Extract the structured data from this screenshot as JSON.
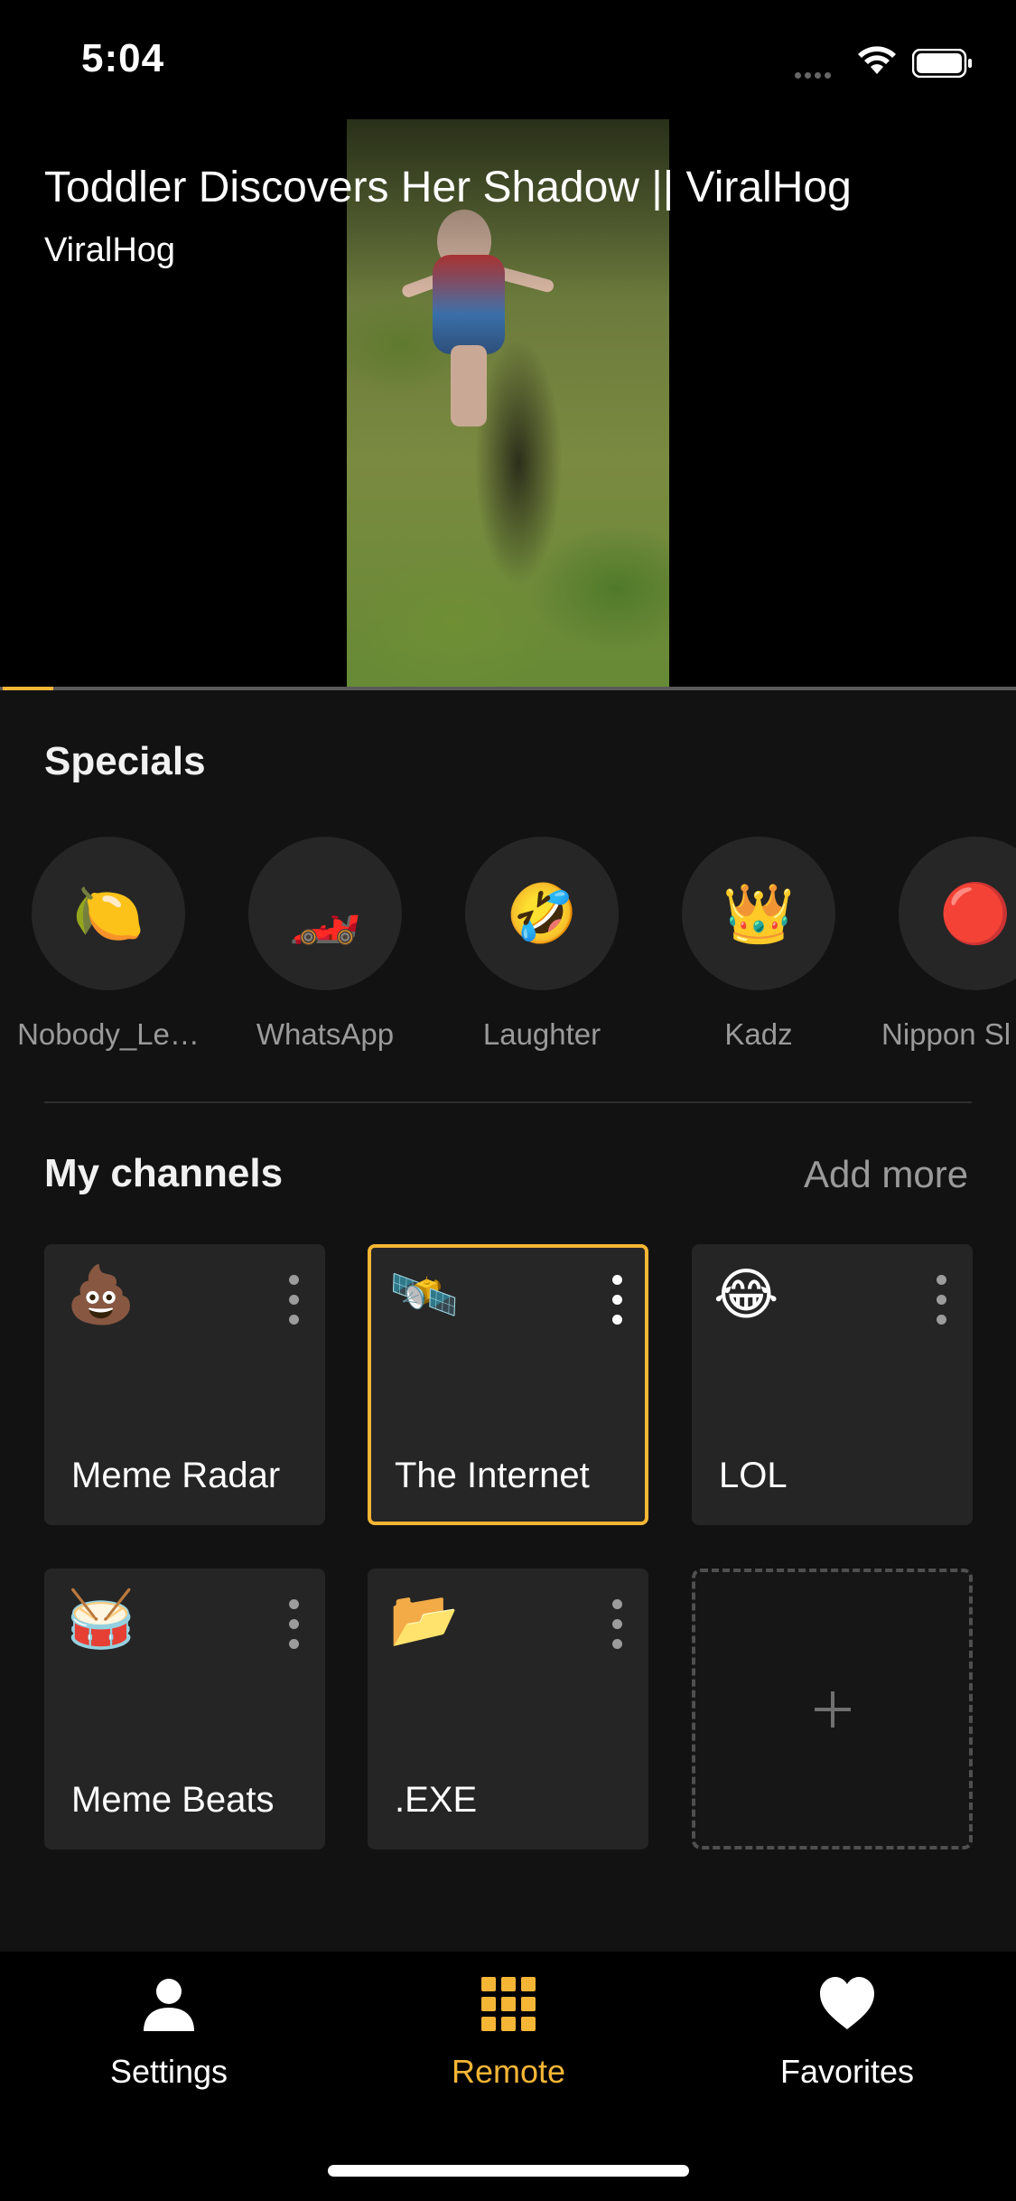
{
  "status_bar": {
    "time": "5:04"
  },
  "video": {
    "title": "Toddler Discovers Her Shadow || ViralHog",
    "channel": "ViralHog",
    "progress": 0.05
  },
  "specials": {
    "title": "Specials",
    "items": [
      {
        "label": "Nobody_Le…",
        "icon": "🍋"
      },
      {
        "label": "WhatsApp",
        "icon": "🏎️"
      },
      {
        "label": "Laughter",
        "icon": "🤣"
      },
      {
        "label": "Kadz",
        "icon": "👑"
      },
      {
        "label": "Nippon Sl",
        "icon": "🔴"
      }
    ]
  },
  "channels": {
    "title": "My channels",
    "add_more": "Add more",
    "items": [
      {
        "label": "Meme Radar",
        "icon": "💩"
      },
      {
        "label": "The Internet",
        "icon": "🛰️",
        "selected": true
      },
      {
        "label": "LOL",
        "icon": "😂"
      },
      {
        "label": "Meme Beats",
        "icon": "🥁"
      },
      {
        "label": ".EXE",
        "icon": "📂"
      }
    ],
    "add_tile_icon": "plus-icon"
  },
  "tab_bar": {
    "tabs": [
      {
        "label": "Settings",
        "icon": "person-icon"
      },
      {
        "label": "Remote",
        "icon": "grid-icon",
        "active": true
      },
      {
        "label": "Favorites",
        "icon": "heart-icon"
      }
    ]
  },
  "colors": {
    "accent": "#f5b535",
    "background": "#121212",
    "tile": "#252525"
  }
}
